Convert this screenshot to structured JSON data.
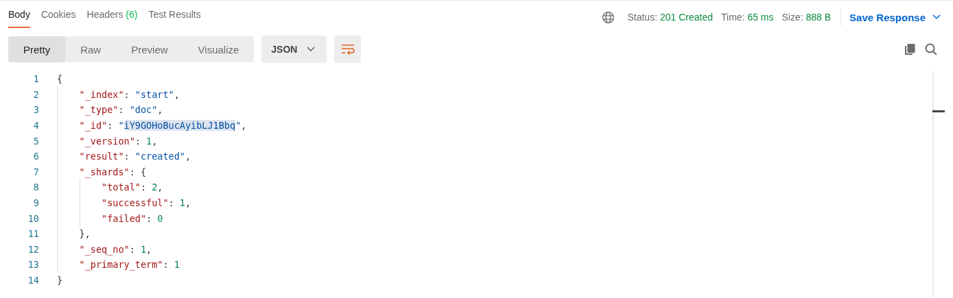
{
  "tabs": [
    {
      "label": "Body",
      "selected": true
    },
    {
      "label": "Cookies",
      "selected": false
    },
    {
      "label": "Headers",
      "count": "(6)",
      "selected": false
    },
    {
      "label": "Test Results",
      "selected": false
    }
  ],
  "response_meta": [
    {
      "label": "Status:",
      "value": "201 Created"
    },
    {
      "label": "Time:",
      "value": "65 ms"
    },
    {
      "label": "Size:",
      "value": "888 B"
    }
  ],
  "save_button": {
    "label": "Save Response"
  },
  "view_modes": [
    {
      "label": "Pretty",
      "selected": true
    },
    {
      "label": "Raw",
      "selected": false
    },
    {
      "label": "Preview",
      "selected": false
    },
    {
      "label": "Visualize",
      "selected": false
    }
  ],
  "format_dropdown": {
    "value": "JSON"
  },
  "code_lines": [
    {
      "number": "1",
      "tokens": [
        {
          "kind": "punct",
          "text": "{"
        }
      ]
    },
    {
      "number": "2",
      "tokens": [
        {
          "kind": "key",
          "text": "    \"_index\""
        },
        {
          "kind": "punct",
          "text": ": "
        },
        {
          "kind": "string",
          "text": "\"start\""
        },
        {
          "kind": "punct",
          "text": ","
        }
      ]
    },
    {
      "number": "3",
      "tokens": [
        {
          "kind": "key",
          "text": "    \"_type\""
        },
        {
          "kind": "punct",
          "text": ": "
        },
        {
          "kind": "string",
          "text": "\"doc\""
        },
        {
          "kind": "punct",
          "text": ","
        }
      ]
    },
    {
      "number": "4",
      "tokens": [
        {
          "kind": "key",
          "text": "    \"_id\""
        },
        {
          "kind": "punct",
          "text": ": "
        },
        {
          "kind": "string",
          "text": "\""
        },
        {
          "kind": "selected-string",
          "text": "iY9GOHoBucAyibLJ1Bbq"
        },
        {
          "kind": "string",
          "text": "\""
        },
        {
          "kind": "punct",
          "text": ","
        }
      ]
    },
    {
      "number": "5",
      "tokens": [
        {
          "kind": "key",
          "text": "    \"_version\""
        },
        {
          "kind": "punct",
          "text": ": "
        },
        {
          "kind": "number",
          "text": "1"
        },
        {
          "kind": "punct",
          "text": ","
        }
      ]
    },
    {
      "number": "6",
      "tokens": [
        {
          "kind": "key",
          "text": "    \"result\""
        },
        {
          "kind": "punct",
          "text": ": "
        },
        {
          "kind": "string",
          "text": "\"created\""
        },
        {
          "kind": "punct",
          "text": ","
        }
      ]
    },
    {
      "number": "7",
      "tokens": [
        {
          "kind": "key",
          "text": "    \"_shards\""
        },
        {
          "kind": "punct",
          "text": ": {"
        }
      ]
    },
    {
      "number": "8",
      "tokens": [
        {
          "kind": "key",
          "text": "        \"total\""
        },
        {
          "kind": "punct",
          "text": ": "
        },
        {
          "kind": "number",
          "text": "2"
        },
        {
          "kind": "punct",
          "text": ","
        }
      ]
    },
    {
      "number": "9",
      "tokens": [
        {
          "kind": "key",
          "text": "        \"successful\""
        },
        {
          "kind": "punct",
          "text": ": "
        },
        {
          "kind": "number",
          "text": "1"
        },
        {
          "kind": "punct",
          "text": ","
        }
      ]
    },
    {
      "number": "10",
      "tokens": [
        {
          "kind": "key",
          "text": "        \"failed\""
        },
        {
          "kind": "punct",
          "text": ": "
        },
        {
          "kind": "number",
          "text": "0"
        }
      ]
    },
    {
      "number": "11",
      "tokens": [
        {
          "kind": "punct",
          "text": "    },"
        }
      ]
    },
    {
      "number": "12",
      "tokens": [
        {
          "kind": "key",
          "text": "    \"_seq_no\""
        },
        {
          "kind": "punct",
          "text": ": "
        },
        {
          "kind": "number",
          "text": "1"
        },
        {
          "kind": "punct",
          "text": ","
        }
      ]
    },
    {
      "number": "13",
      "tokens": [
        {
          "kind": "key",
          "text": "    \"_primary_term\""
        },
        {
          "kind": "punct",
          "text": ": "
        },
        {
          "kind": "number",
          "text": "1"
        }
      ]
    },
    {
      "number": "14",
      "tokens": [
        {
          "kind": "punct",
          "text": "}"
        }
      ]
    }
  ]
}
